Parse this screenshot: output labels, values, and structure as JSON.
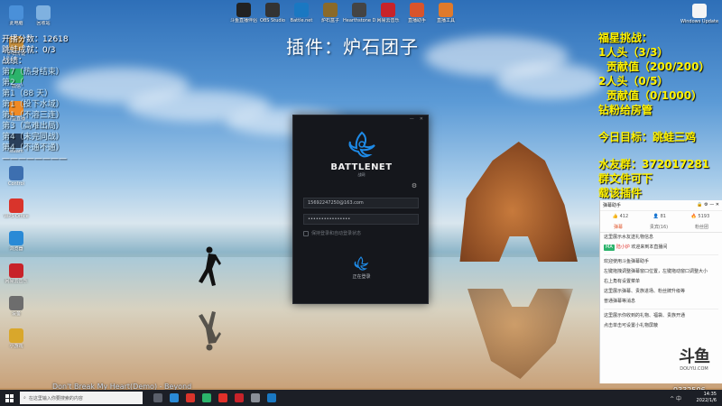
{
  "overlay": {
    "plugin_title": "插件：炉石团子",
    "left_stats": [
      {
        "text": "开播分数：12618",
        "dim": false
      },
      {
        "text": "跳蛙成就：0/3",
        "dim": false
      },
      {
        "text": "战绩：",
        "dim": false
      },
      {
        "text": "第7（热身结束）",
        "dim": true
      },
      {
        "text": "第2（ ",
        "dim": true
      },
      {
        "text": "第1（88 天）",
        "dim": true
      },
      {
        "text": "第1（投下水域）",
        "dim": true
      },
      {
        "text": "第1（不溶三连）",
        "dim": true
      },
      {
        "text": "第3（高难出局）",
        "dim": true
      },
      {
        "text": "第4（未完同战）",
        "dim": true
      },
      {
        "text": "第4（不通不通）",
        "dim": true
      },
      {
        "text": "————————",
        "dim": false
      }
    ],
    "right_stats": {
      "line1": "福星挑战：",
      "line2": "1人头（3/3）",
      "line3": "贡献值（200/200）",
      "line4": "2人头（0/5）",
      "line5": "贡献值（0/1000）",
      "line6": "钻粉给房管",
      "line7": "今日目标：跳蛙三鸡",
      "line8": "水友群：372017281",
      "line9": "群文件可下",
      "line10": "载该插件"
    },
    "song": "Don't Break My Heart(Demo) - Beyond",
    "room_id": "9332506"
  },
  "desktop_icons": [
    {
      "label": "此电脑",
      "color": "#4a90d9"
    },
    {
      "label": "回收站",
      "color": "#7fb1e0"
    },
    {
      "label": "炉石传说",
      "color": "#c08a3a"
    },
    {
      "label": "微信",
      "color": "#2bb36b"
    },
    {
      "label": "斗鱼直播",
      "color": "#f08a24"
    },
    {
      "label": "steam",
      "color": "#2a3f5a"
    },
    {
      "label": "Control",
      "color": "#3d6fb0"
    },
    {
      "label": "WPS Office",
      "color": "#d9342b"
    },
    {
      "label": "浏览器",
      "color": "#2a8ad6"
    },
    {
      "label": "网易云音乐",
      "color": "#c8232a"
    },
    {
      "label": "设备",
      "color": "#6d6d6d"
    },
    {
      "label": "小游戏",
      "color": "#d9a72b"
    }
  ],
  "top_icons": [
    {
      "label": "斗鱼直播伴侣",
      "color": "#222"
    },
    {
      "label": "OBS Studio",
      "color": "#333"
    },
    {
      "label": "Battle.net",
      "color": "#1a78c2"
    },
    {
      "label": "炉石盒子",
      "color": "#8a6a2a"
    },
    {
      "label": "Hearthstone Deck Tracker",
      "color": "#444"
    },
    {
      "label": "网易云音乐",
      "color": "#c8232a"
    },
    {
      "label": "直播助手",
      "color": "#d9542b"
    },
    {
      "label": "直播工具",
      "color": "#e07a2b"
    }
  ],
  "windows_update": "Windows Update Bl...",
  "bnet": {
    "brand": "BATTLENET",
    "brand_sub": "战网",
    "email": "15692247250@163.com",
    "password": "••••••••••••••••",
    "remember": "保持登录和自动登录状态",
    "status": "正在登录"
  },
  "chat": {
    "title": "弹幕助手",
    "stats": [
      "412",
      "81",
      "5193"
    ],
    "tabs": [
      "弹幕",
      "贵宾(16)",
      "粉丝团"
    ],
    "active_tab": 0,
    "messages": [
      {
        "text": "这里展示水友送礼物信息",
        "type": "plain"
      },
      {
        "text": "欢迎来到本直播间",
        "user": "MA",
        "name": "陆小炉",
        "type": "user"
      },
      {
        "text": "欢迎使用斗鱼弹幕助手",
        "type": "plain"
      },
      {
        "text": "左键拖拽调整弹幕窗口位置，左键拖动窗口调整大小",
        "type": "plain"
      },
      {
        "text": "右上角有设置菜单",
        "type": "plain"
      },
      {
        "text": "这里展示弹幕、贵族进场、粉丝牌升级等",
        "type": "plain"
      },
      {
        "text": "普通弹幕等消息",
        "type": "plain"
      },
      {
        "text": "这里展示你收到的礼物、福袋、贵族开通",
        "type": "plain"
      },
      {
        "text": "点击单击可设置小礼物屏蔽",
        "type": "plain"
      }
    ],
    "douyu_mark": "斗鱼",
    "douyu_url": "DOUYU.COM"
  },
  "taskbar": {
    "search_placeholder": "在这里输入你要搜索的内容",
    "clock_time": "14:35",
    "clock_date": "2022/1/6",
    "tray": "^ 中"
  }
}
